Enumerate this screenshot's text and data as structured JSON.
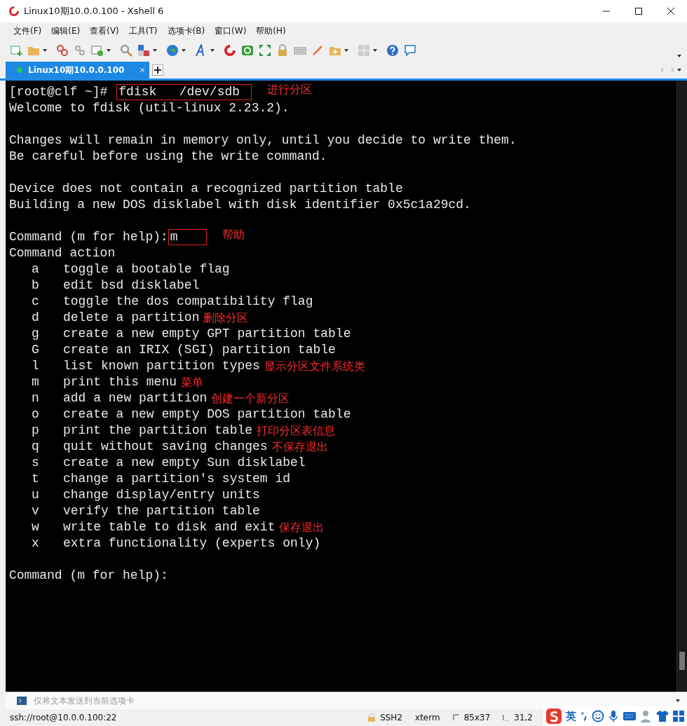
{
  "window": {
    "title": "Linux10期10.0.0.100 - Xshell 6"
  },
  "menu": [
    "文件(F)",
    "编辑(E)",
    "查看(V)",
    "工具(T)",
    "选项卡(B)",
    "窗口(W)",
    "帮助(H)"
  ],
  "tabs": [
    {
      "label": "Linux10期10.0.0.100",
      "selected": true,
      "connected": true
    }
  ],
  "terminal": {
    "lines": [
      {
        "kind": "input",
        "prompt": "[root@clf ~]# ",
        "input": "fdisk   /dev/sdb",
        "note": "进行分区"
      },
      {
        "kind": "output",
        "text": "Welcome to fdisk (util-linux 2.23.2)."
      },
      {
        "kind": "blank"
      },
      {
        "kind": "output",
        "text": "Changes will remain in memory only, until you decide to write them."
      },
      {
        "kind": "output",
        "text": "Be careful before using the write command."
      },
      {
        "kind": "blank"
      },
      {
        "kind": "output",
        "text": "Device does not contain a recognized partition table"
      },
      {
        "kind": "output",
        "text": "Building a new DOS disklabel with disk identifier 0x5c1a29cd."
      },
      {
        "kind": "blank"
      },
      {
        "kind": "input",
        "prompt": "Command (m for help):",
        "input": "m",
        "note": "帮助"
      },
      {
        "kind": "output",
        "text": "Command action"
      },
      {
        "kind": "option",
        "key": "a",
        "text": "toggle a bootable flag"
      },
      {
        "kind": "option",
        "key": "b",
        "text": "edit bsd disklabel"
      },
      {
        "kind": "option",
        "key": "c",
        "text": "toggle the dos compatibility flag"
      },
      {
        "kind": "option",
        "key": "d",
        "text": "delete a partition",
        "note": "删除分区"
      },
      {
        "kind": "option",
        "key": "g",
        "text": "create a new empty GPT partition table"
      },
      {
        "kind": "option",
        "key": "G",
        "text": "create an IRIX (SGI) partition table"
      },
      {
        "kind": "option",
        "key": "l",
        "text": "list known partition types",
        "note": "显示分区文件系统类"
      },
      {
        "kind": "option",
        "key": "m",
        "text": "print this menu",
        "note": "菜单"
      },
      {
        "kind": "option",
        "key": "n",
        "text": "add a new partition",
        "note": "创建一个新分区"
      },
      {
        "kind": "option",
        "key": "o",
        "text": "create a new empty DOS partition table"
      },
      {
        "kind": "option",
        "key": "p",
        "text": "print the partition table",
        "note": "打印分区表信息"
      },
      {
        "kind": "option",
        "key": "q",
        "text": "quit without saving changes",
        "note": "不保存退出"
      },
      {
        "kind": "option",
        "key": "s",
        "text": "create a new empty Sun disklabel"
      },
      {
        "kind": "option",
        "key": "t",
        "text": "change a partition's system id"
      },
      {
        "kind": "option",
        "key": "u",
        "text": "change display/entry units"
      },
      {
        "kind": "option",
        "key": "v",
        "text": "verify the partition table"
      },
      {
        "kind": "option",
        "key": "w",
        "text": "write table to disk and exit",
        "note": "保存退出"
      },
      {
        "kind": "option",
        "key": "x",
        "text": "extra functionality (experts only)"
      },
      {
        "kind": "blank"
      },
      {
        "kind": "output",
        "text": "Command (m for help):"
      }
    ]
  },
  "send_bar": {
    "placeholder": "仅将文本发送到当前选项卡"
  },
  "status_bar": {
    "address": "ssh://root@10.0.0.100:22",
    "protocol": "SSH2",
    "terminal_type": "xterm",
    "size": "85x37",
    "cursor": "31,2"
  },
  "ime_bar": {
    "language": "英"
  }
}
